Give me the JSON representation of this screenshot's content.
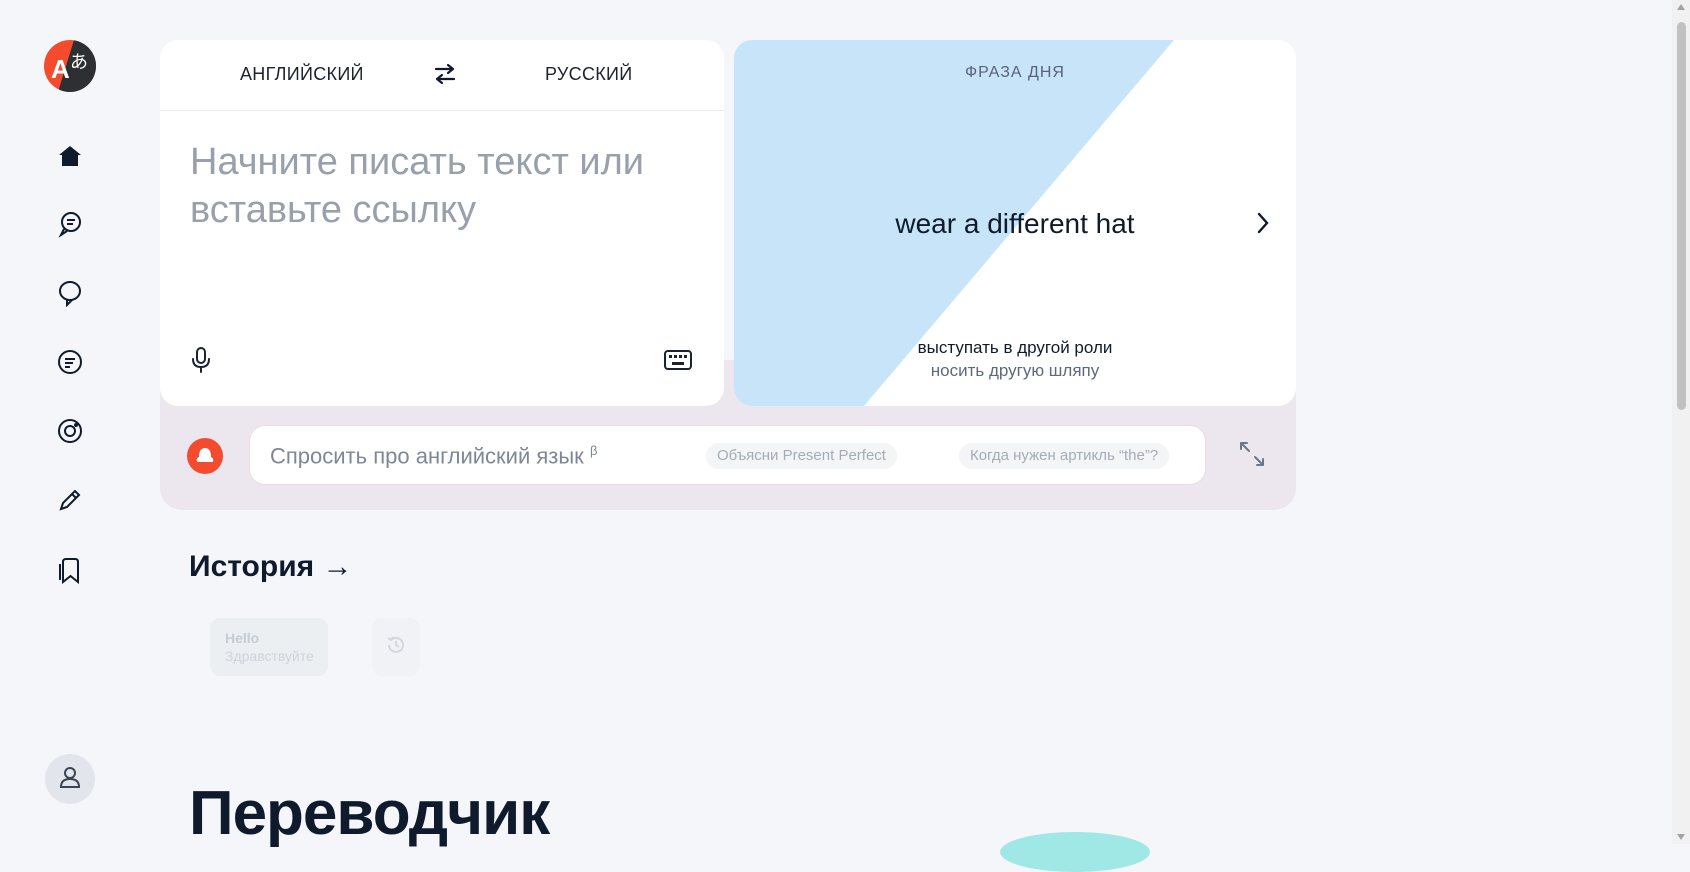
{
  "sidebar": {
    "logo_icon": "translate-logo-icon",
    "items": [
      {
        "icon": "home-icon"
      },
      {
        "icon": "chat-bubbles-icon"
      },
      {
        "icon": "speech-bubble-icon"
      },
      {
        "icon": "message-lines-icon"
      },
      {
        "icon": "camera-icon"
      },
      {
        "icon": "pencil-icon"
      },
      {
        "icon": "bookmarks-icon"
      }
    ],
    "profile_icon": "user-icon"
  },
  "translator": {
    "source_lang": "АНГЛИЙСКИЙ",
    "target_lang": "РУССКИЙ",
    "swap_icon": "swap-arrows-icon",
    "placeholder": "Начните писать текст или вставьте ссылку",
    "mic_icon": "microphone-icon",
    "keyboard_icon": "keyboard-icon"
  },
  "phrase_of_day": {
    "label": "ФРАЗА ДНЯ",
    "phrase": "wear a different hat",
    "translation_1": "выступать в другой роли",
    "translation_2": "носить другую шляпу",
    "next_icon": "chevron-right-icon"
  },
  "ask": {
    "assistant_icon": "alice-assistant-icon",
    "placeholder": "Спросить про английский язык",
    "beta": "β",
    "suggestions": [
      "Объясни Present Perfect",
      "Когда нужен артикль “the”?"
    ],
    "expand_icon": "expand-arrows-icon"
  },
  "history": {
    "title": "История",
    "arrow": "→",
    "items": [
      {
        "source": "Hello",
        "translation": "Здравствуйте"
      }
    ],
    "more_icon": "history-icon"
  },
  "hero": {
    "title": "Переводчик"
  },
  "colors": {
    "background": "#f4f6fa",
    "brand_red": "#f24b2e",
    "phrase_blue": "#c8e4f8",
    "ask_strip": "#ece6ee"
  }
}
